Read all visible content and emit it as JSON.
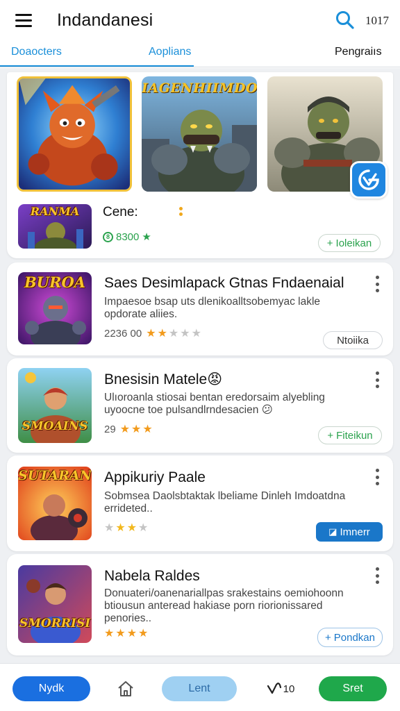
{
  "app": {
    "title": "Indandanesi",
    "counter": "1017"
  },
  "tabs": [
    {
      "label": "Doaocters"
    },
    {
      "label": "Aoplians"
    },
    {
      "label": "Pengraiıs"
    }
  ],
  "featured": {
    "items": [
      {
        "caption": ""
      },
      {
        "caption": "IAGENHIIMDORI"
      },
      {
        "caption": ""
      }
    ],
    "badge_icon": "g-brand-icon",
    "app_thumb_caption": "RANMA",
    "app_name": "Cene:",
    "rating": "8300",
    "action_label": "Ioleikan"
  },
  "list": [
    {
      "thumb_caption": "BUROA",
      "title": "Saes Desimlapack Gtnas Fndaenaial",
      "desc": "Impaesoe bsap uts dlenikoalltsobemyac lakle opdorate aliies.",
      "meta": "2236 00",
      "stars_on": 2,
      "action_label": "Ntoiika",
      "action_style": "gray"
    },
    {
      "thumb_caption": "SMOAINS",
      "title": "Bnesisin Matele😡",
      "desc": "Ulıoroanla stiosai bentan eredorsaim alyebling uyoocne toe pulsandlrndesacien 😕",
      "meta": "29",
      "stars_on": 3,
      "action_label": "Fiteikun",
      "action_style": "green"
    },
    {
      "thumb_caption": "SUTARAN",
      "title": "Appikuriy Paale",
      "desc": "Sobmsea Daolsbtaktak lbeliame Dinleh Imdoatdna errideted..",
      "meta": "",
      "stars_on": 2,
      "action_label": "Imnerr",
      "action_style": "blue"
    },
    {
      "thumb_caption": "SMORRISI",
      "title": "Nabela Raldes",
      "desc": "Donuateri/oanenariallpas srakestains oemiohoonn btiousun anteread hakiase porn riorionissared penories..",
      "meta": "",
      "stars_on": 4,
      "action_label": "Pondkan",
      "action_style": "blue-outline"
    }
  ],
  "bottom_nav": {
    "left_label": "Nydk",
    "home_icon": "home-icon",
    "center_label": "Lent",
    "badge_label": "10",
    "right_label": "Sret"
  },
  "colors": {
    "accent": "#1a8fd9",
    "green": "#1fa84b",
    "blue": "#1a6fe0",
    "star": "#f29b1d"
  }
}
